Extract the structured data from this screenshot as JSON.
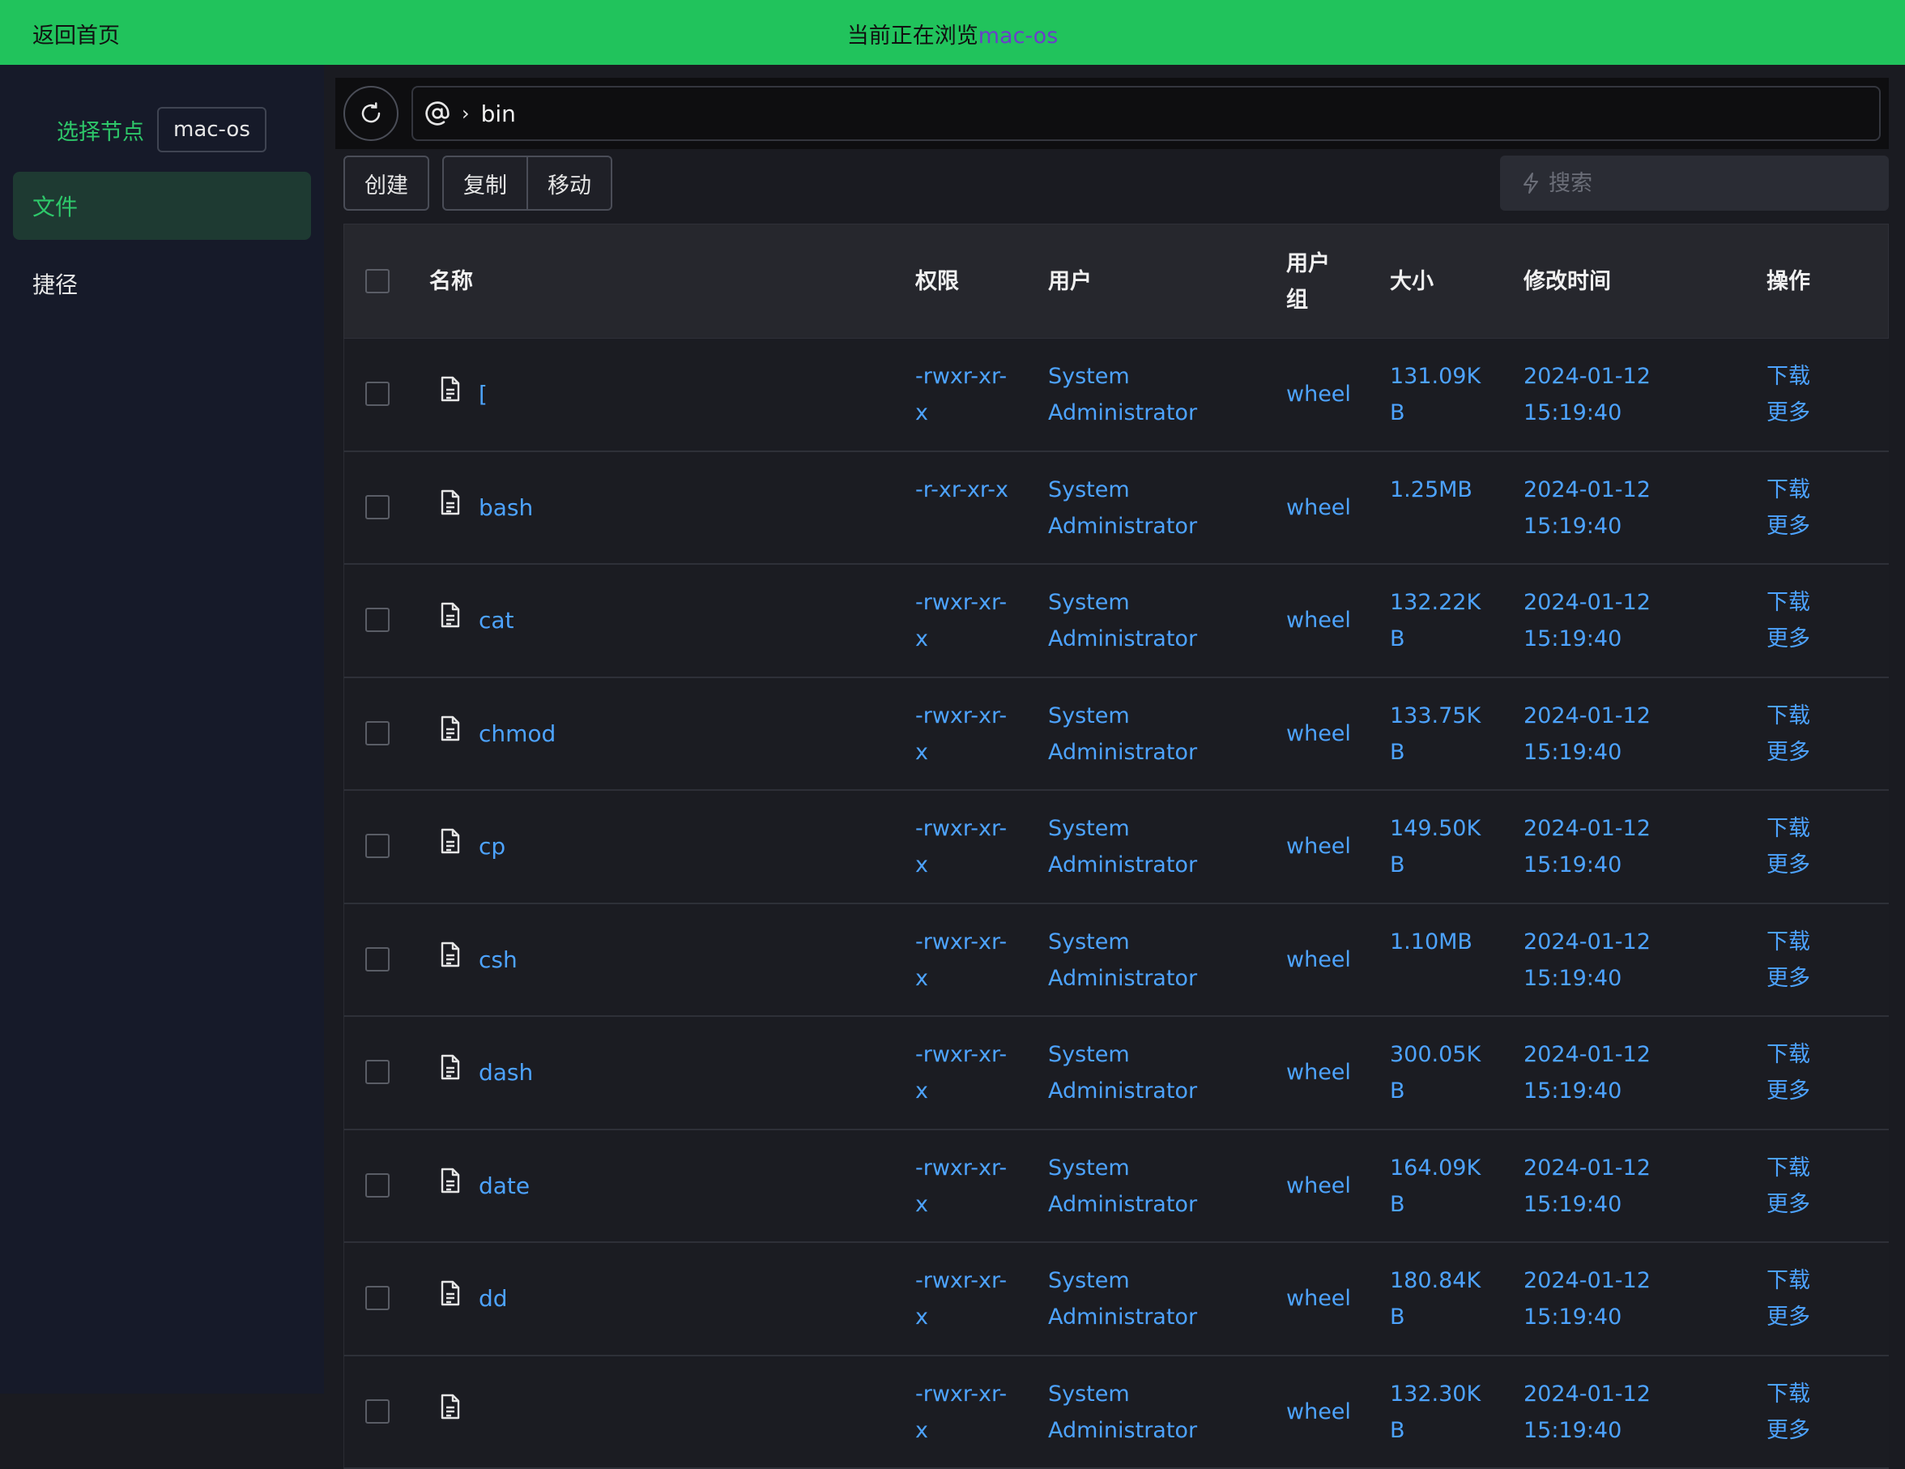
{
  "topbar": {
    "back": "返回首页",
    "browsing_prefix": "当前正在浏览",
    "node_name": "mac-os"
  },
  "sidebar": {
    "node_label": "选择节点",
    "node_value": "mac-os",
    "items": [
      {
        "label": "文件"
      },
      {
        "label": "捷径"
      }
    ]
  },
  "path": {
    "segment": "bin"
  },
  "toolbar": {
    "create": "创建",
    "copy": "复制",
    "move": "移动",
    "search_placeholder": "搜索"
  },
  "table": {
    "headers": {
      "name": "名称",
      "perm": "权限",
      "user": "用户",
      "group_line1": "用户",
      "group_line2": "组",
      "size": "大小",
      "mtime": "修改时间",
      "ops": "操作"
    },
    "action_download": "下载",
    "action_more": "更多",
    "rows": [
      {
        "name": "[",
        "perm1": "-rwxr-xr-",
        "perm2": "x",
        "user1": "System",
        "user2": "Administrator",
        "group": "wheel",
        "size1": "131.09K",
        "size2": "B",
        "date": "2024-01-12",
        "time": "15:19:40"
      },
      {
        "name": "bash",
        "perm1": "-r-xr-xr-x",
        "perm2": "",
        "user1": "System",
        "user2": "Administrator",
        "group": "wheel",
        "size1": "1.25MB",
        "size2": "",
        "date": "2024-01-12",
        "time": "15:19:40"
      },
      {
        "name": "cat",
        "perm1": "-rwxr-xr-",
        "perm2": "x",
        "user1": "System",
        "user2": "Administrator",
        "group": "wheel",
        "size1": "132.22K",
        "size2": "B",
        "date": "2024-01-12",
        "time": "15:19:40"
      },
      {
        "name": "chmod",
        "perm1": "-rwxr-xr-",
        "perm2": "x",
        "user1": "System",
        "user2": "Administrator",
        "group": "wheel",
        "size1": "133.75K",
        "size2": "B",
        "date": "2024-01-12",
        "time": "15:19:40"
      },
      {
        "name": "cp",
        "perm1": "-rwxr-xr-",
        "perm2": "x",
        "user1": "System",
        "user2": "Administrator",
        "group": "wheel",
        "size1": "149.50K",
        "size2": "B",
        "date": "2024-01-12",
        "time": "15:19:40"
      },
      {
        "name": "csh",
        "perm1": "-rwxr-xr-",
        "perm2": "x",
        "user1": "System",
        "user2": "Administrator",
        "group": "wheel",
        "size1": "1.10MB",
        "size2": "",
        "date": "2024-01-12",
        "time": "15:19:40"
      },
      {
        "name": "dash",
        "perm1": "-rwxr-xr-",
        "perm2": "x",
        "user1": "System",
        "user2": "Administrator",
        "group": "wheel",
        "size1": "300.05K",
        "size2": "B",
        "date": "2024-01-12",
        "time": "15:19:40"
      },
      {
        "name": "date",
        "perm1": "-rwxr-xr-",
        "perm2": "x",
        "user1": "System",
        "user2": "Administrator",
        "group": "wheel",
        "size1": "164.09K",
        "size2": "B",
        "date": "2024-01-12",
        "time": "15:19:40"
      },
      {
        "name": "dd",
        "perm1": "-rwxr-xr-",
        "perm2": "x",
        "user1": "System",
        "user2": "Administrator",
        "group": "wheel",
        "size1": "180.84K",
        "size2": "B",
        "date": "2024-01-12",
        "time": "15:19:40"
      },
      {
        "name": "",
        "perm1": "-rwxr-xr-",
        "perm2": "x",
        "user1": "System",
        "user2": "Administrator",
        "group": "wheel",
        "size1": "132.30K",
        "size2": "B",
        "date": "2024-01-12",
        "time": "15:19:40"
      }
    ]
  },
  "colors": {
    "accent_green": "#21c35c",
    "link_blue": "#4da3ff",
    "node_purple": "#6a3fc9",
    "sidebar_bg": "#161a29"
  }
}
